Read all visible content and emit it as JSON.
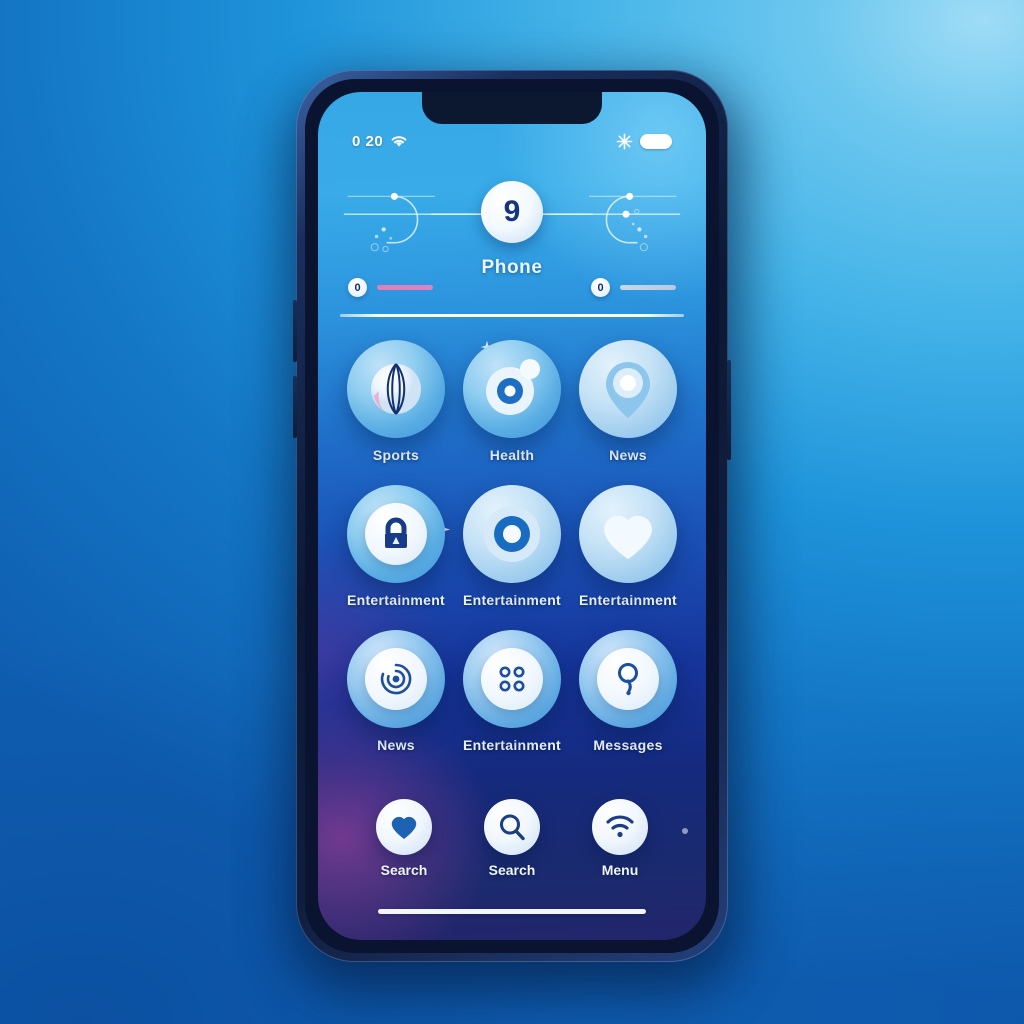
{
  "background": {
    "top_right_color": "#6ec8ef",
    "center_color": "#1a8ad4",
    "bottom_left_color": "#0f5db0"
  },
  "device": {
    "name": "smartphone-mockup",
    "frame_color": "#0d1933",
    "screen_top_color": "#37a8e6",
    "screen_bottom_color": "#23256b",
    "accent_color": "#e07fb8"
  },
  "status_bar": {
    "time": "0 20",
    "wifi_icon": "wifi-icon",
    "bluetooth_icon": "star-burst-icon",
    "battery_icon": "battery-icon"
  },
  "widget": {
    "badge_value": "9",
    "title": "Phone",
    "left_meter": {
      "value": "0",
      "bar_color": "#e07fb8"
    },
    "right_meter": {
      "value": "0",
      "bar_color": "#c9d7ea"
    }
  },
  "app_grid": {
    "rows": [
      {
        "apps": [
          {
            "label": "Sports",
            "icon": "striped-ball-icon"
          },
          {
            "label": "Health",
            "icon": "lens-circle-icon"
          },
          {
            "label": "News",
            "icon": "location-pin-icon"
          }
        ]
      },
      {
        "apps": [
          {
            "label": "Entertainment",
            "icon": "lock-icon"
          },
          {
            "label": "Entertainment",
            "icon": "donut-circle-icon"
          },
          {
            "label": "Entertainment",
            "icon": "heart-icon"
          }
        ]
      },
      {
        "apps": [
          {
            "label": "News",
            "icon": "spiral-target-icon"
          },
          {
            "label": "Entertainment",
            "icon": "four-dots-grid-icon"
          },
          {
            "label": "Messages",
            "icon": "question-pin-icon"
          }
        ]
      }
    ]
  },
  "dock": {
    "items": [
      {
        "label": "Search",
        "icon": "heart-icon"
      },
      {
        "label": "Search",
        "icon": "magnifier-icon"
      },
      {
        "label": "Menu",
        "icon": "wifi-icon"
      }
    ]
  }
}
